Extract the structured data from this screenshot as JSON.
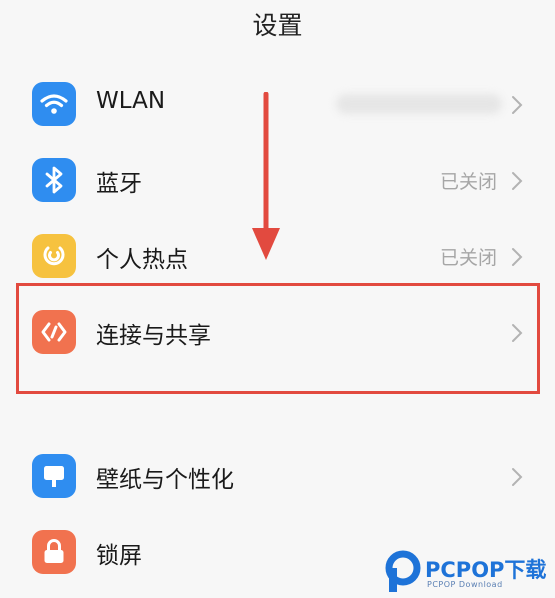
{
  "header": {
    "title": "设置"
  },
  "settings": {
    "wlan": {
      "label": "WLAN",
      "value": "",
      "icon": "wifi-icon",
      "color": "#2f8df0"
    },
    "bluetooth": {
      "label": "蓝牙",
      "value": "已关闭",
      "icon": "bluetooth-icon",
      "color": "#2f8df0"
    },
    "hotspot": {
      "label": "个人热点",
      "value": "已关闭",
      "icon": "hotspot-icon",
      "color": "#f6c23f"
    },
    "connection": {
      "label": "连接与共享",
      "value": "",
      "icon": "share-icon",
      "color": "#f1724f"
    },
    "wallpaper": {
      "label": "壁纸与个性化",
      "value": "",
      "icon": "wallpaper-icon",
      "color": "#2f8df0"
    },
    "lockscreen": {
      "label": "锁屏",
      "value": "",
      "icon": "lock-icon",
      "color": "#f1724f"
    }
  },
  "annotation": {
    "highlight_color": "#e24a3f"
  },
  "watermark": {
    "brand": "PCPOP下载",
    "sub": "PCPOP Download"
  }
}
